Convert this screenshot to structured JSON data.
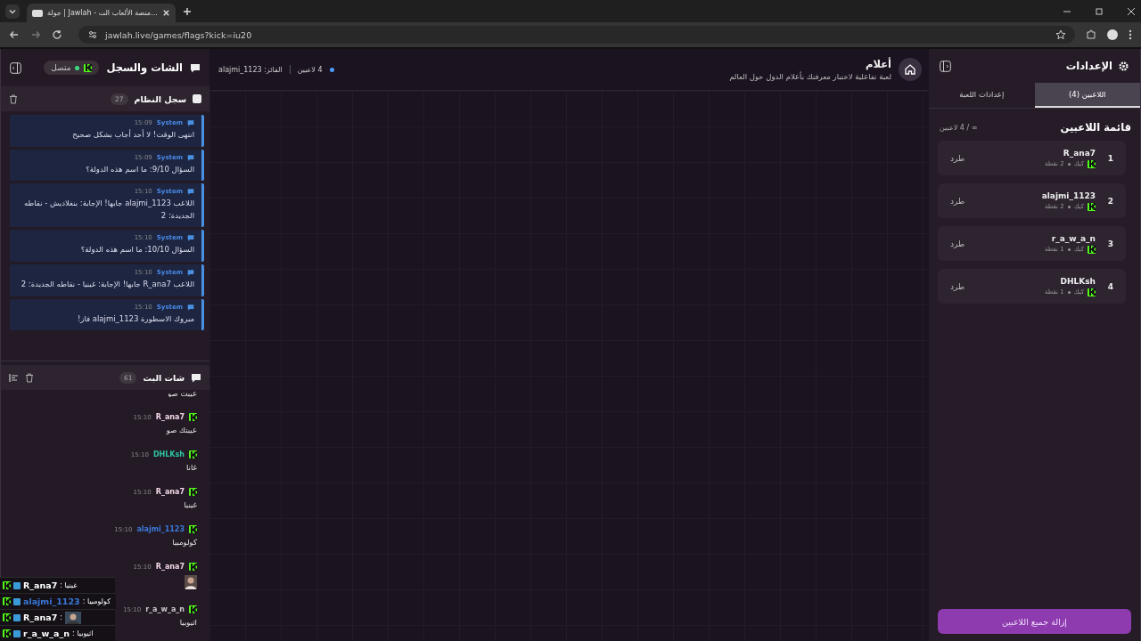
{
  "browser": {
    "tab_title": "جولة | Jawlah - منصة الألعاب الت...",
    "url": "jawlah.live/games/flags?kick=iu20"
  },
  "chat_panel": {
    "title": "الشات والسجل",
    "status": "متصل",
    "connected": true
  },
  "system_log": {
    "title": "سجل النظام",
    "count": "27",
    "entries": [
      {
        "sender": "System",
        "time": "15:09",
        "text": "انتهى الوقت! لا أحد أجاب بشكل صحيح"
      },
      {
        "sender": "System",
        "time": "15:09",
        "text": "السؤال 9/10: ما اسم هذه الدولة؟"
      },
      {
        "sender": "System",
        "time": "15:10",
        "text": "اللاعب alajmi_1123 جابها! الإجابة: بنغلاديش - نقاطه الجديدة: 2"
      },
      {
        "sender": "System",
        "time": "15:10",
        "text": "السؤال 10/10: ما اسم هذه الدولة؟"
      },
      {
        "sender": "System",
        "time": "15:10",
        "text": "اللاعب R_ana7 جابها! الإجابة: غينيا - نقاطه الجديدة: 2"
      },
      {
        "sender": "System",
        "time": "15:10",
        "text": "مبروك الاسطورة alajmi_1123 فاز!"
      }
    ]
  },
  "live_chat": {
    "title": "شات البث",
    "count": "61",
    "messages": [
      {
        "kind": "partial",
        "text": "عيبت صو"
      },
      {
        "kind": "text",
        "user": "R_ana7",
        "time": "15:10",
        "text": "عيبتك صو",
        "color": "#f2d6e6"
      },
      {
        "kind": "text",
        "user": "DHLKsh",
        "time": "15:10",
        "text": "غانا",
        "color": "#2ec4a0"
      },
      {
        "kind": "text",
        "user": "R_ana7",
        "time": "15:10",
        "text": "غينيا",
        "color": "#f2d6e6"
      },
      {
        "kind": "text",
        "user": "alajmi_1123",
        "time": "15:10",
        "text": "كولومبيا",
        "color": "#3a78d8"
      },
      {
        "kind": "image",
        "user": "R_ana7",
        "time": "15:10",
        "color": "#f2d6e6"
      },
      {
        "kind": "text",
        "user": "r_a_w_a_n",
        "time": "15:10",
        "text": "اثيوبيا",
        "color": "#c8c8c8"
      }
    ]
  },
  "stream_overlay": [
    {
      "kind": "text",
      "user": "R_ana7",
      "text": ": غينيا",
      "color": "#ffffff"
    },
    {
      "kind": "text",
      "user": "alajmi_1123",
      "text": ": كولومبيا",
      "color": "#3a78d8"
    },
    {
      "kind": "image",
      "user": "R_ana7",
      "text": ":",
      "color": "#ffffff"
    },
    {
      "kind": "text",
      "user": "r_a_w_a_n",
      "text": ": اثيوبيا",
      "color": "#ffffff"
    }
  ],
  "game_header": {
    "title": "أعلام",
    "subtitle": "لعبة تفاعلية لاختبار معرفتك بأعلام الدول حول العالم",
    "players": "4 لاعبين",
    "winner": "الفائز: alajmi_1123"
  },
  "settings": {
    "title": "الإعدادات",
    "tabs": [
      {
        "label": "اللاعبين (4)",
        "selected": true
      },
      {
        "label": "إعدادات اللعبة",
        "selected": false
      }
    ],
    "list_title": "قائمة اللاعبين",
    "limit": "∞ / 4 لاعبين",
    "players": [
      {
        "rank": "1",
        "name": "R_ana7",
        "platform": "كيك",
        "points": "2 نقطة",
        "action": "طرد"
      },
      {
        "rank": "2",
        "name": "alajmi_1123",
        "platform": "كيك",
        "points": "2 نقطة",
        "action": "طرد"
      },
      {
        "rank": "3",
        "name": "r_a_w_a_n",
        "platform": "كيك",
        "points": "1 نقطة",
        "action": "طرد"
      },
      {
        "rank": "4",
        "name": "DHLKsh",
        "platform": "كيك",
        "points": "1 نقطة",
        "action": "طرد"
      }
    ],
    "remove_all": "إزالة جميع اللاعبين"
  }
}
